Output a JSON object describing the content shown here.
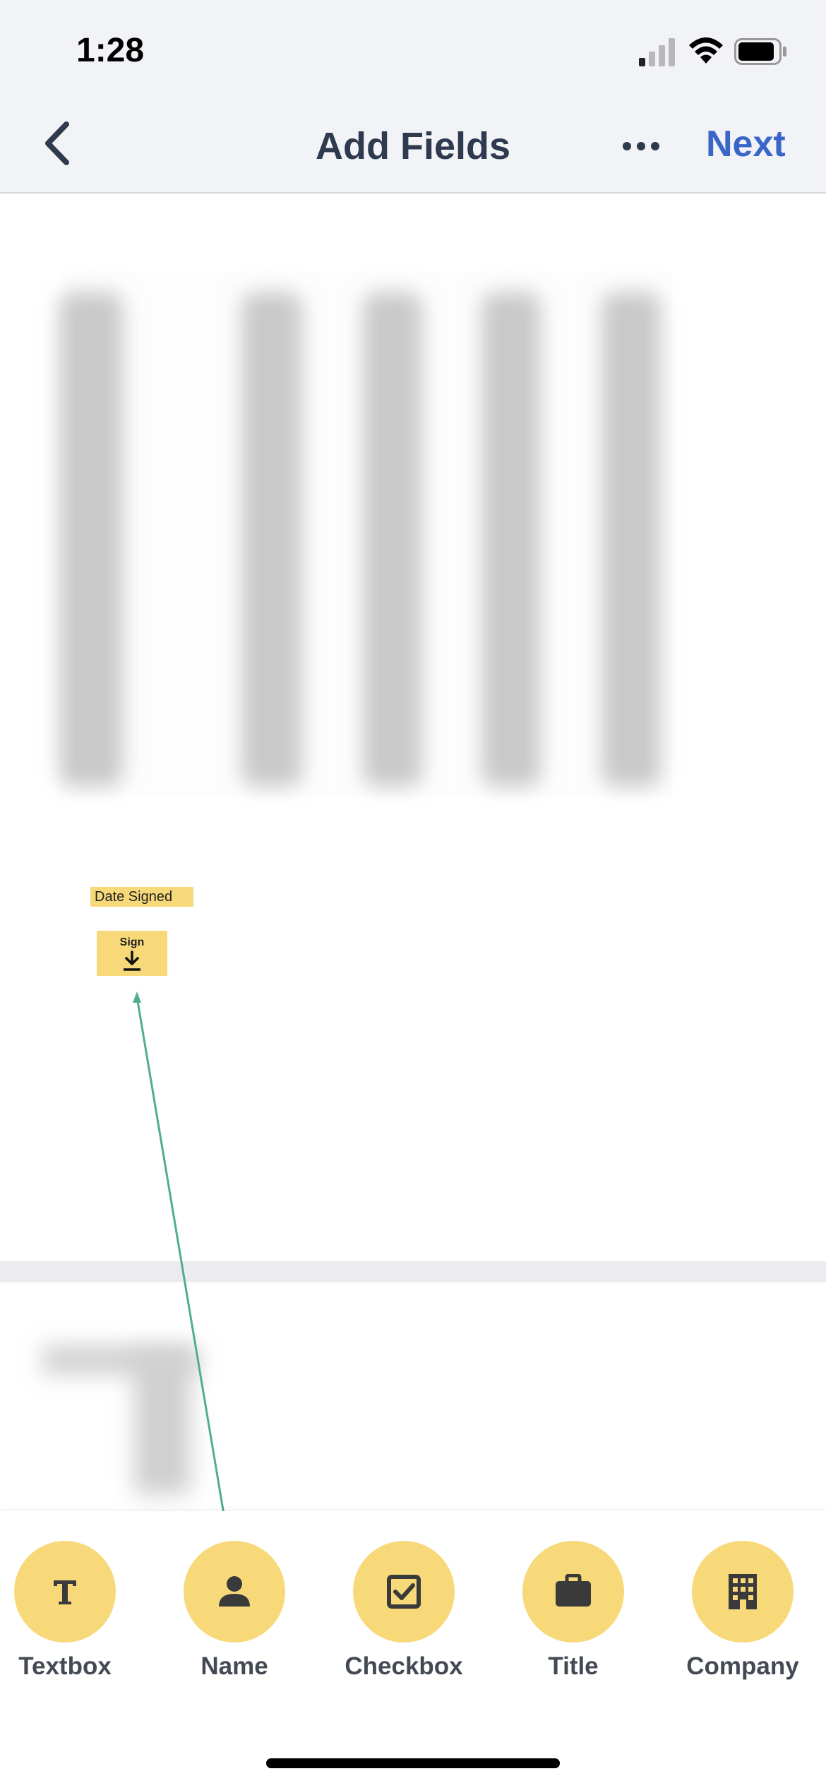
{
  "status_bar": {
    "time": "1:28"
  },
  "nav": {
    "title": "Add Fields",
    "next_label": "Next"
  },
  "document": {
    "field_date_signed": "Date Signed",
    "field_sign": "Sign"
  },
  "toolbar": {
    "items": [
      {
        "label": "Textbox",
        "icon": "textbox-icon"
      },
      {
        "label": "Name",
        "icon": "person-icon"
      },
      {
        "label": "Checkbox",
        "icon": "checkbox-icon"
      },
      {
        "label": "Title",
        "icon": "briefcase-icon"
      },
      {
        "label": "Company",
        "icon": "building-icon"
      }
    ]
  },
  "colors": {
    "accent": "#3a66c8",
    "field_fill": "#f7d97a",
    "connector": "#4fae8f",
    "nav_bg": "#f2f3f7"
  }
}
